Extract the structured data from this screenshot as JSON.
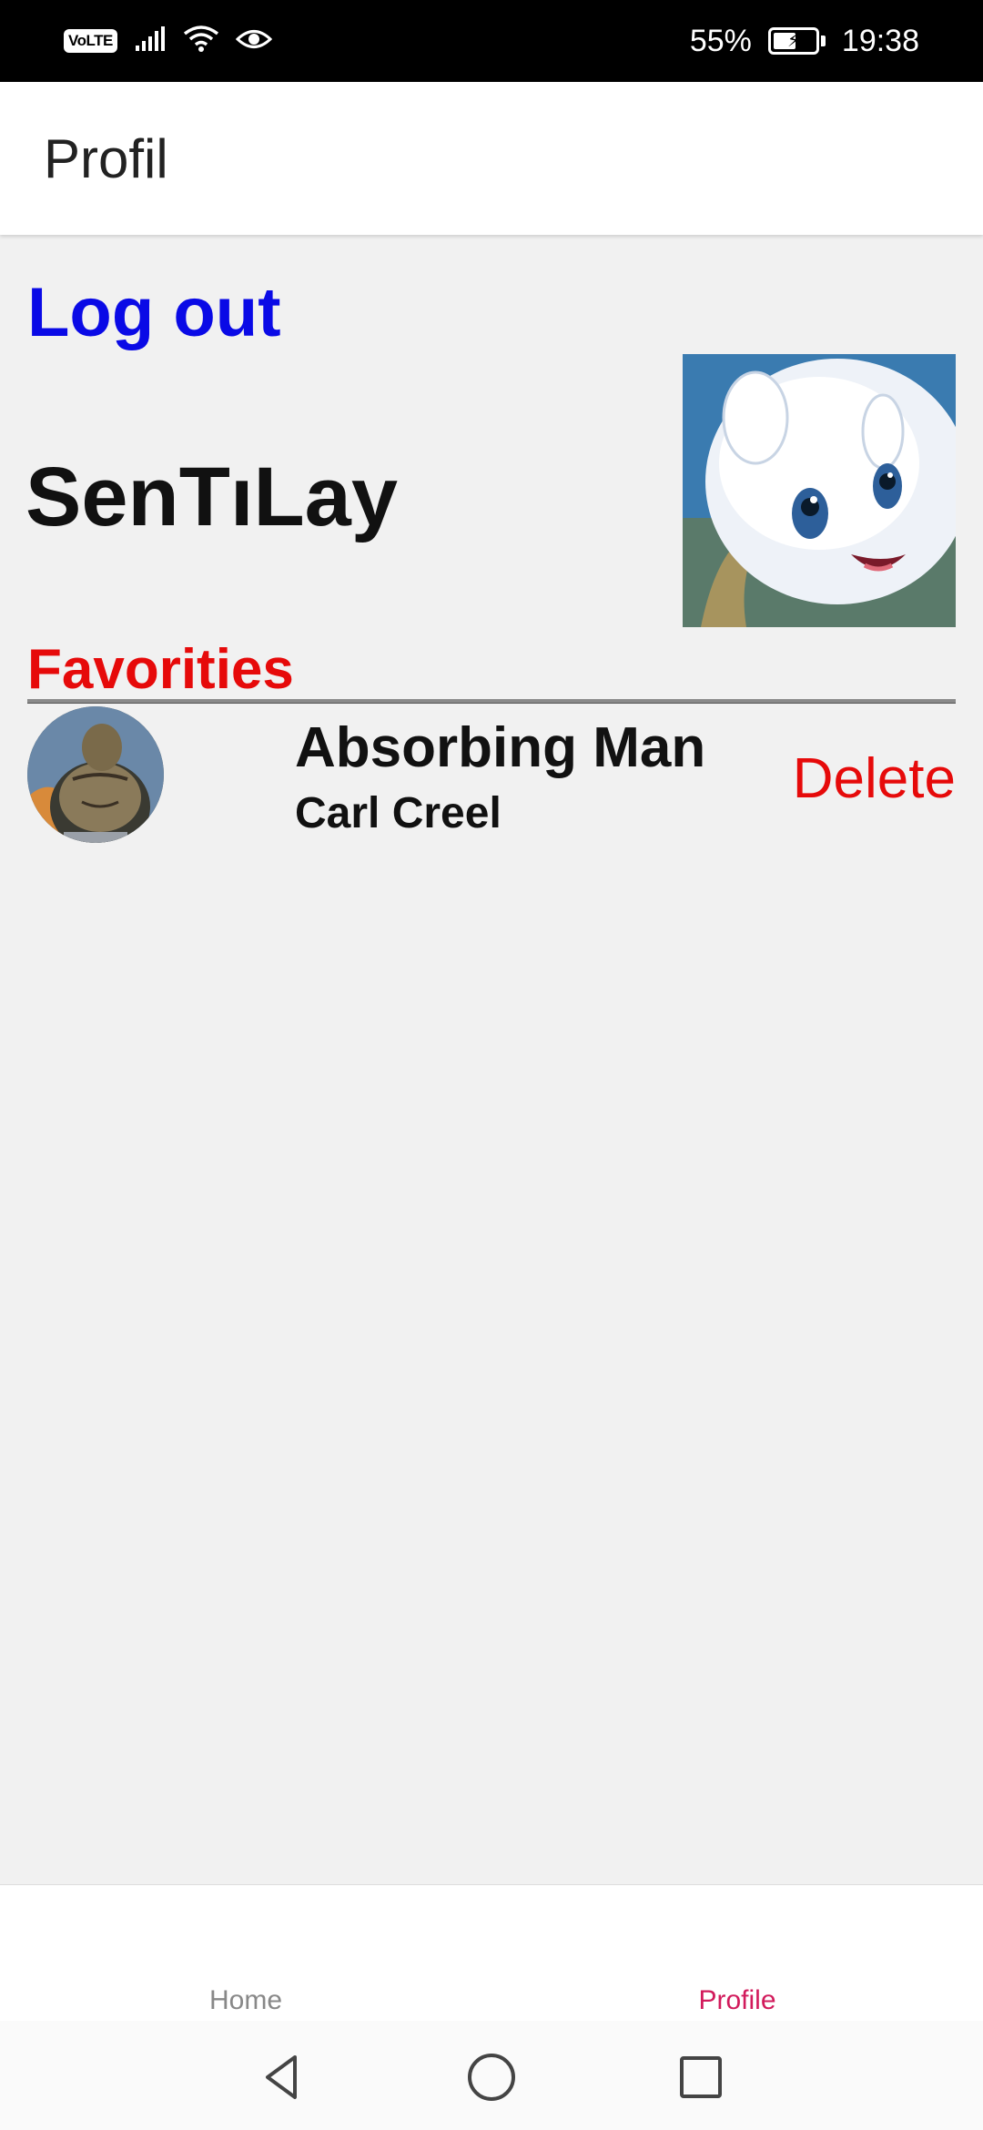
{
  "status_bar": {
    "volte": "VoLTE",
    "battery_percent": "55%",
    "battery_level": 0.55,
    "time": "19:38"
  },
  "app_bar": {
    "title": "Profil"
  },
  "profile": {
    "logout_label": "Log out",
    "username": "SenTıLay"
  },
  "favorites": {
    "title": "Favorities",
    "items": [
      {
        "name": "Absorbing Man",
        "real_name": "Carl Creel",
        "action_label": "Delete"
      }
    ]
  },
  "bottom_nav": {
    "items": [
      {
        "label": "Home",
        "active": false
      },
      {
        "label": "Profile",
        "active": true
      }
    ],
    "active_color": "#d21b5c"
  },
  "colors": {
    "logout": "#0a0ae6",
    "favorites": "#e60a0a",
    "delete": "#e60a0a"
  },
  "icons": {
    "signal": "signal-icon",
    "wifi": "wifi-icon",
    "eye": "eye-icon",
    "battery": "battery-icon",
    "back": "back-triangle-icon",
    "home": "home-circle-icon",
    "recents": "recents-square-icon"
  }
}
